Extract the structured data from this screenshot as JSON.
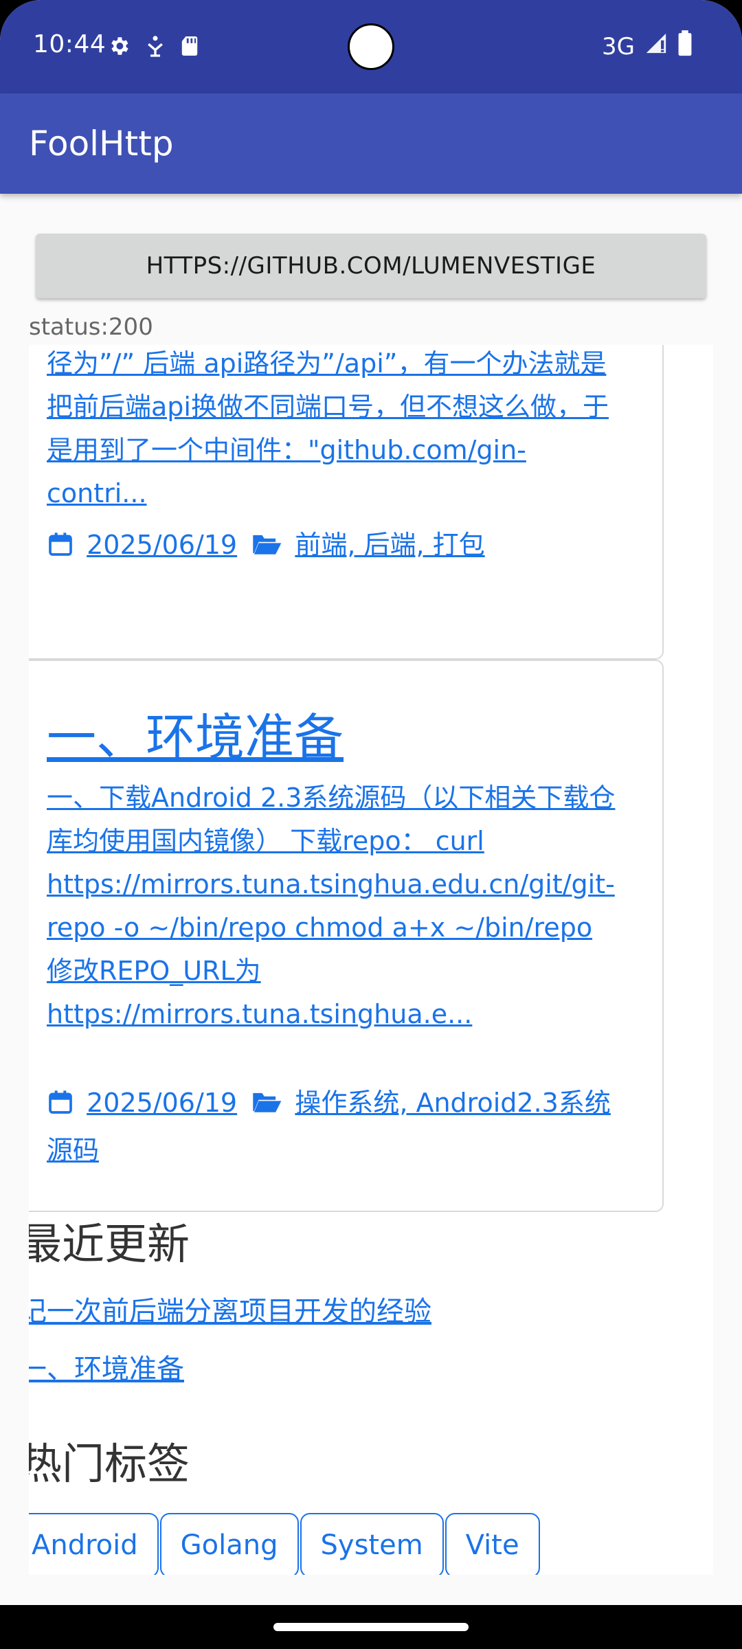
{
  "status_bar": {
    "time": "10:44",
    "network": "3G"
  },
  "app_bar": {
    "title": "FoolHttp"
  },
  "url_button": {
    "label": "HTTPS://GITHUB.COM/LUMENVESTIGE"
  },
  "status_line": "status:200",
  "cards": [
    {
      "excerpt": "径为”/” 后端 api路径为”/api”，有一个办法就是把前后端api换做不同端口号，但不想这么做，于是用到了一个中间件：\"github.com/gin-contri...",
      "date": "2025/06/19",
      "categories": "前端, 后端, 打包"
    },
    {
      "title": "一、环境准备",
      "excerpt": "一、下载Android 2.3系统源码（以下相关下载仓库均使用国内镜像） 下载repo： curl https://mirrors.tuna.tsinghua.edu.cn/git/git-repo -o ~/bin/repo chmod a+x ~/bin/repo 修改REPO_URL为 https://mirrors.tuna.tsinghua.e...",
      "date": "2025/06/19",
      "categories": "操作系统, Android2.3系统源码"
    }
  ],
  "recent": {
    "heading": "最近更新",
    "items": [
      "记一次前后端分离项目开发的经验",
      "一、环境准备"
    ]
  },
  "tags": {
    "heading": "热门标签",
    "items": [
      "Android",
      "Golang",
      "System",
      "Vite"
    ]
  },
  "colors": {
    "status_bar": "#303f9f",
    "app_bar": "#3f51b5",
    "link": "#1a73e8"
  }
}
